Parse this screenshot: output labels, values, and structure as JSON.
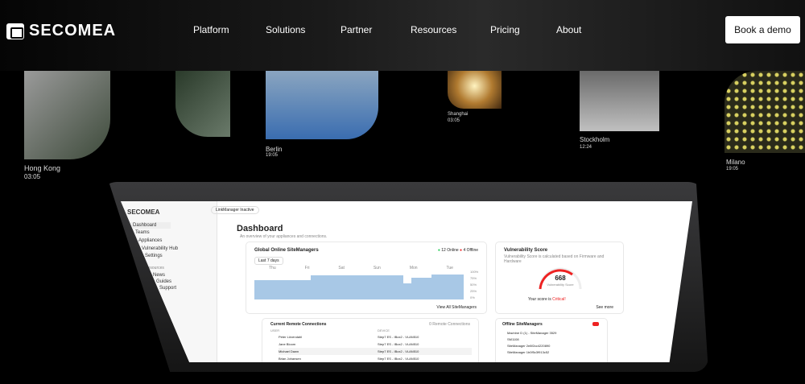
{
  "nav": {
    "brand": "SECOMEA",
    "items": [
      "Platform",
      "Solutions",
      "Partner",
      "Resources",
      "Pricing",
      "About"
    ],
    "cta": "Book a demo"
  },
  "cities": [
    {
      "name": "Hong Kong",
      "time": "03:05"
    },
    {
      "name": "Berlin",
      "time": "19:05"
    },
    {
      "name": "Shanghai",
      "time": "03:05"
    },
    {
      "name": "Stockholm",
      "time": "12:24"
    },
    {
      "name": "Milano",
      "time": "19:05"
    }
  ],
  "app": {
    "brand": "SECOMEA",
    "status": "LinkManager Inactive",
    "sidebar": [
      "Dashboard",
      "Teams",
      "Appliances",
      "Vulnerability Hub",
      "Settings"
    ],
    "resources_label": "Resources",
    "resources": [
      "News",
      "Guides",
      "Support"
    ],
    "title": "Dashboard",
    "subtitle": "An overview of your appliances and connections.",
    "online_card": {
      "title": "Global Online SiteManagers",
      "online": "12 Online",
      "offline": "4 Offline",
      "range": "Last 7 days",
      "days": [
        "Thu",
        "Fri",
        "Sat",
        "Sun",
        "Mon",
        "Tue"
      ],
      "yticks": [
        "100%",
        "75%",
        "50%",
        "25%",
        "0%"
      ],
      "link": "View All SiteManagers"
    },
    "vuln": {
      "title": "Vulnerability Score",
      "desc": "Vulnerability Score is calculated based on Firmware and Hardware",
      "score": "668",
      "score_label": "Vulnerability Score",
      "verdict_pre": "Your score is",
      "verdict": "Critical!",
      "link": "See more"
    },
    "connections": {
      "title": "Current Remote Connections",
      "count": "0 Remote Connections",
      "col_user": "USER",
      "col_device": "DEVICE",
      "rows": [
        {
          "user": "Peter Lövendahl",
          "device": "Step7 ES - IBox2 - VLAN510"
        },
        {
          "user": "Jane Bloom",
          "device": "Step7 ES - IBox2 - VLAN510"
        },
        {
          "user": "Michael Dawn",
          "device": "Step7 ES - IBox2 - VLAN510"
        },
        {
          "user": "Brian Johansen",
          "device": "Step7 ES - IBox2 - VLAN510"
        }
      ]
    },
    "offline": {
      "title": "Offline SiteManagers",
      "items": [
        "Machine D (1) - SiteManager 3529",
        "SM1108",
        "SiteManager 2e8f2cc4220890",
        "SiteManager 1b0f5c3f913c52"
      ]
    }
  }
}
